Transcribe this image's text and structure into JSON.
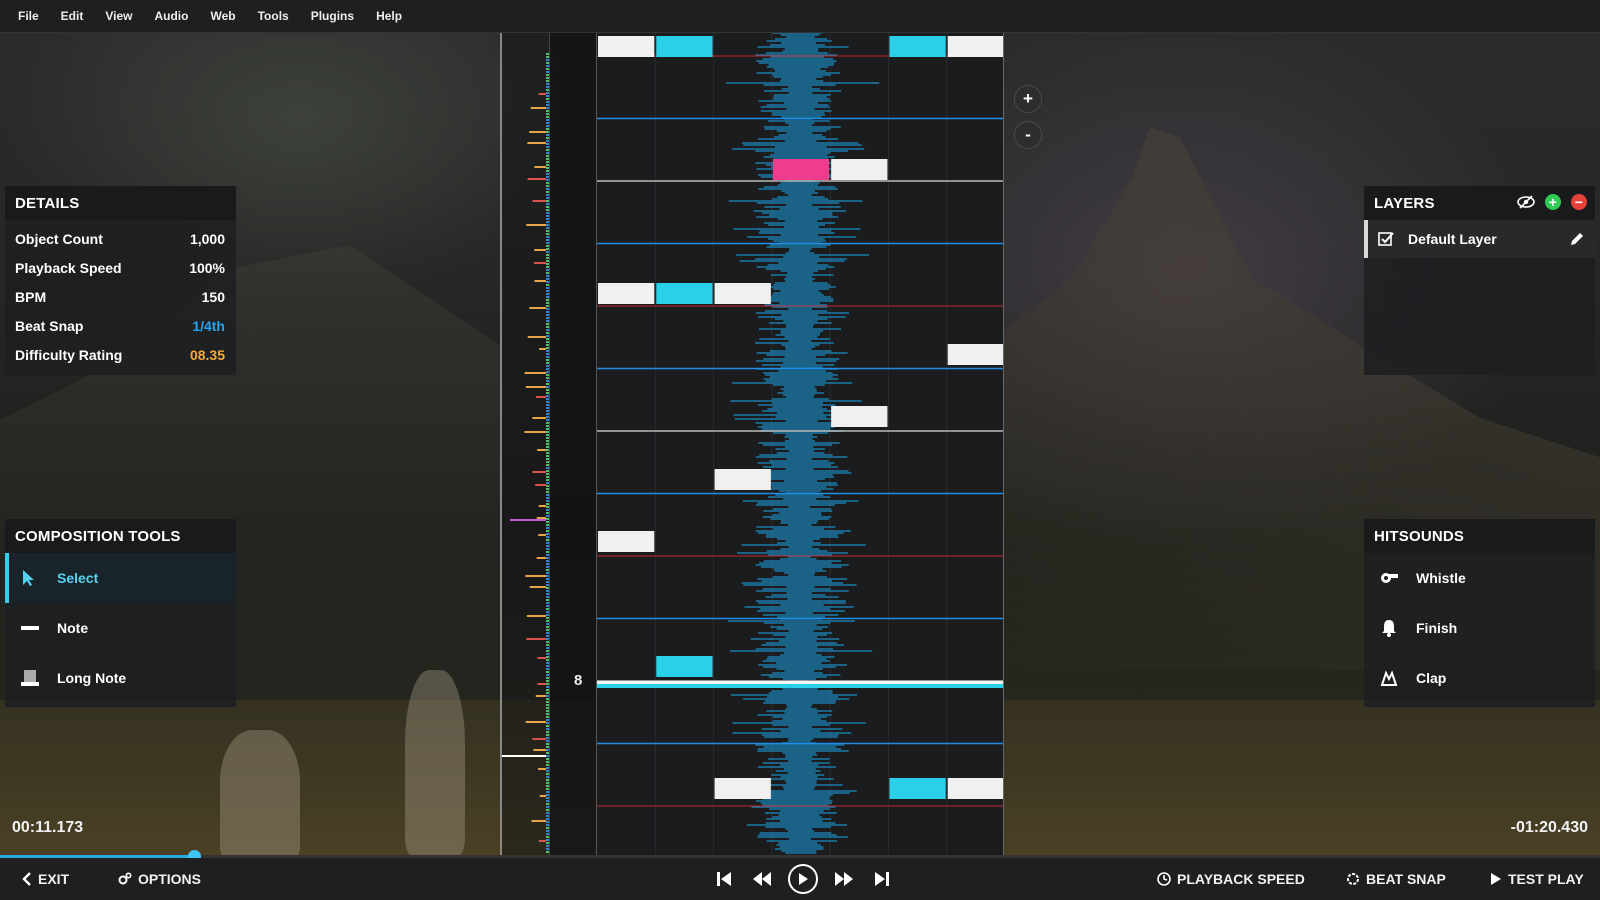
{
  "menu": [
    "File",
    "Edit",
    "View",
    "Audio",
    "Web",
    "Tools",
    "Plugins",
    "Help"
  ],
  "details": {
    "title": "DETAILS",
    "rows": [
      {
        "label": "Object Count",
        "value": "1,000"
      },
      {
        "label": "Playback Speed",
        "value": "100%"
      },
      {
        "label": "BPM",
        "value": "150"
      },
      {
        "label": "Beat Snap",
        "value": "1/4th"
      },
      {
        "label": "Difficulty Rating",
        "value": "08.35"
      }
    ],
    "colors": {
      "beat_snap": "#26a3f0",
      "difficulty": "#f4a83a"
    }
  },
  "composition": {
    "title": "COMPOSITION TOOLS",
    "tools": [
      {
        "label": "Select",
        "icon": "cursor-icon",
        "active": true
      },
      {
        "label": "Note",
        "icon": "note-icon",
        "active": false
      },
      {
        "label": "Long Note",
        "icon": "long-note-icon",
        "active": false
      }
    ]
  },
  "layers": {
    "title": "LAYERS",
    "items": [
      {
        "label": "Default Layer",
        "checked": true
      }
    ]
  },
  "hitsounds": {
    "title": "HITSOUNDS",
    "items": [
      {
        "label": "Whistle",
        "icon": "whistle-icon"
      },
      {
        "label": "Finish",
        "icon": "bell-icon"
      },
      {
        "label": "Clap",
        "icon": "clap-icon"
      }
    ]
  },
  "editor": {
    "beat_number": "8",
    "zoom_in": "+",
    "zoom_out": "-",
    "progress": 0.121
  },
  "time": {
    "current": "00:11.173",
    "remaining": "-01:20.430"
  },
  "bottom": {
    "exit": "EXIT",
    "options": "OPTIONS",
    "playback_speed": "PLAYBACK SPEED",
    "beat_snap": "BEAT SNAP",
    "test_play": "TEST PLAY"
  },
  "colors": {
    "accent": "#3bcbee",
    "note_white": "#f0f0f0",
    "note_cyan": "#2ad0e8",
    "note_pink": "#ee3d8d",
    "waveform": "#1b86b8",
    "beat_line": "#1e8ee8",
    "measure_line": "#d8d8d8",
    "red_line": "#c4262d"
  }
}
